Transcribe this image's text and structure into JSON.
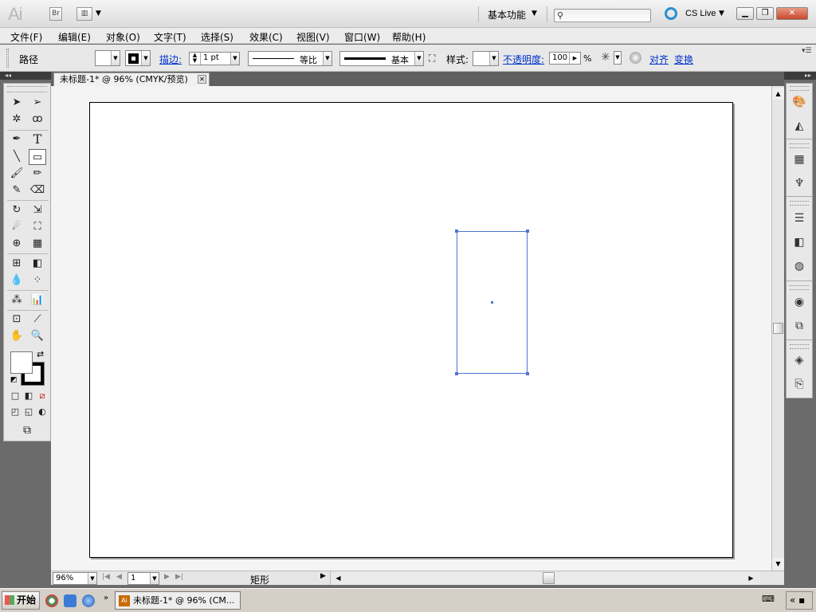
{
  "titlebar": {
    "logo": "Ai",
    "bridge_label": "Br",
    "workspace": "基本功能",
    "search_placeholder": "",
    "cs_live": "CS Live"
  },
  "menu": {
    "items": [
      "文件(F)",
      "编辑(E)",
      "对象(O)",
      "文字(T)",
      "选择(S)",
      "效果(C)",
      "视图(V)",
      "窗口(W)",
      "帮助(H)"
    ]
  },
  "control": {
    "object_type": "路径",
    "stroke_label": "描边:",
    "stroke_weight": "1 pt",
    "profile": "等比",
    "brush": "基本",
    "style_label": "样式:",
    "opacity_label": "不透明度:",
    "opacity_value": "100",
    "opacity_unit": "%",
    "align_label": "对齐",
    "transform_label": "变换"
  },
  "document": {
    "tab_title": "未标题-1* @ 96% (CMYK/预览)"
  },
  "status": {
    "zoom": "96%",
    "page": "1",
    "current_tool": "矩形"
  },
  "taskbar": {
    "start": "开始",
    "task_title": "未标题-1* @ 96% (CM...",
    "task_icon": "Ai"
  },
  "colors": {
    "selection": "#4f74d1",
    "link": "#0033cc",
    "workspace_bg": "#6b6b6b"
  }
}
